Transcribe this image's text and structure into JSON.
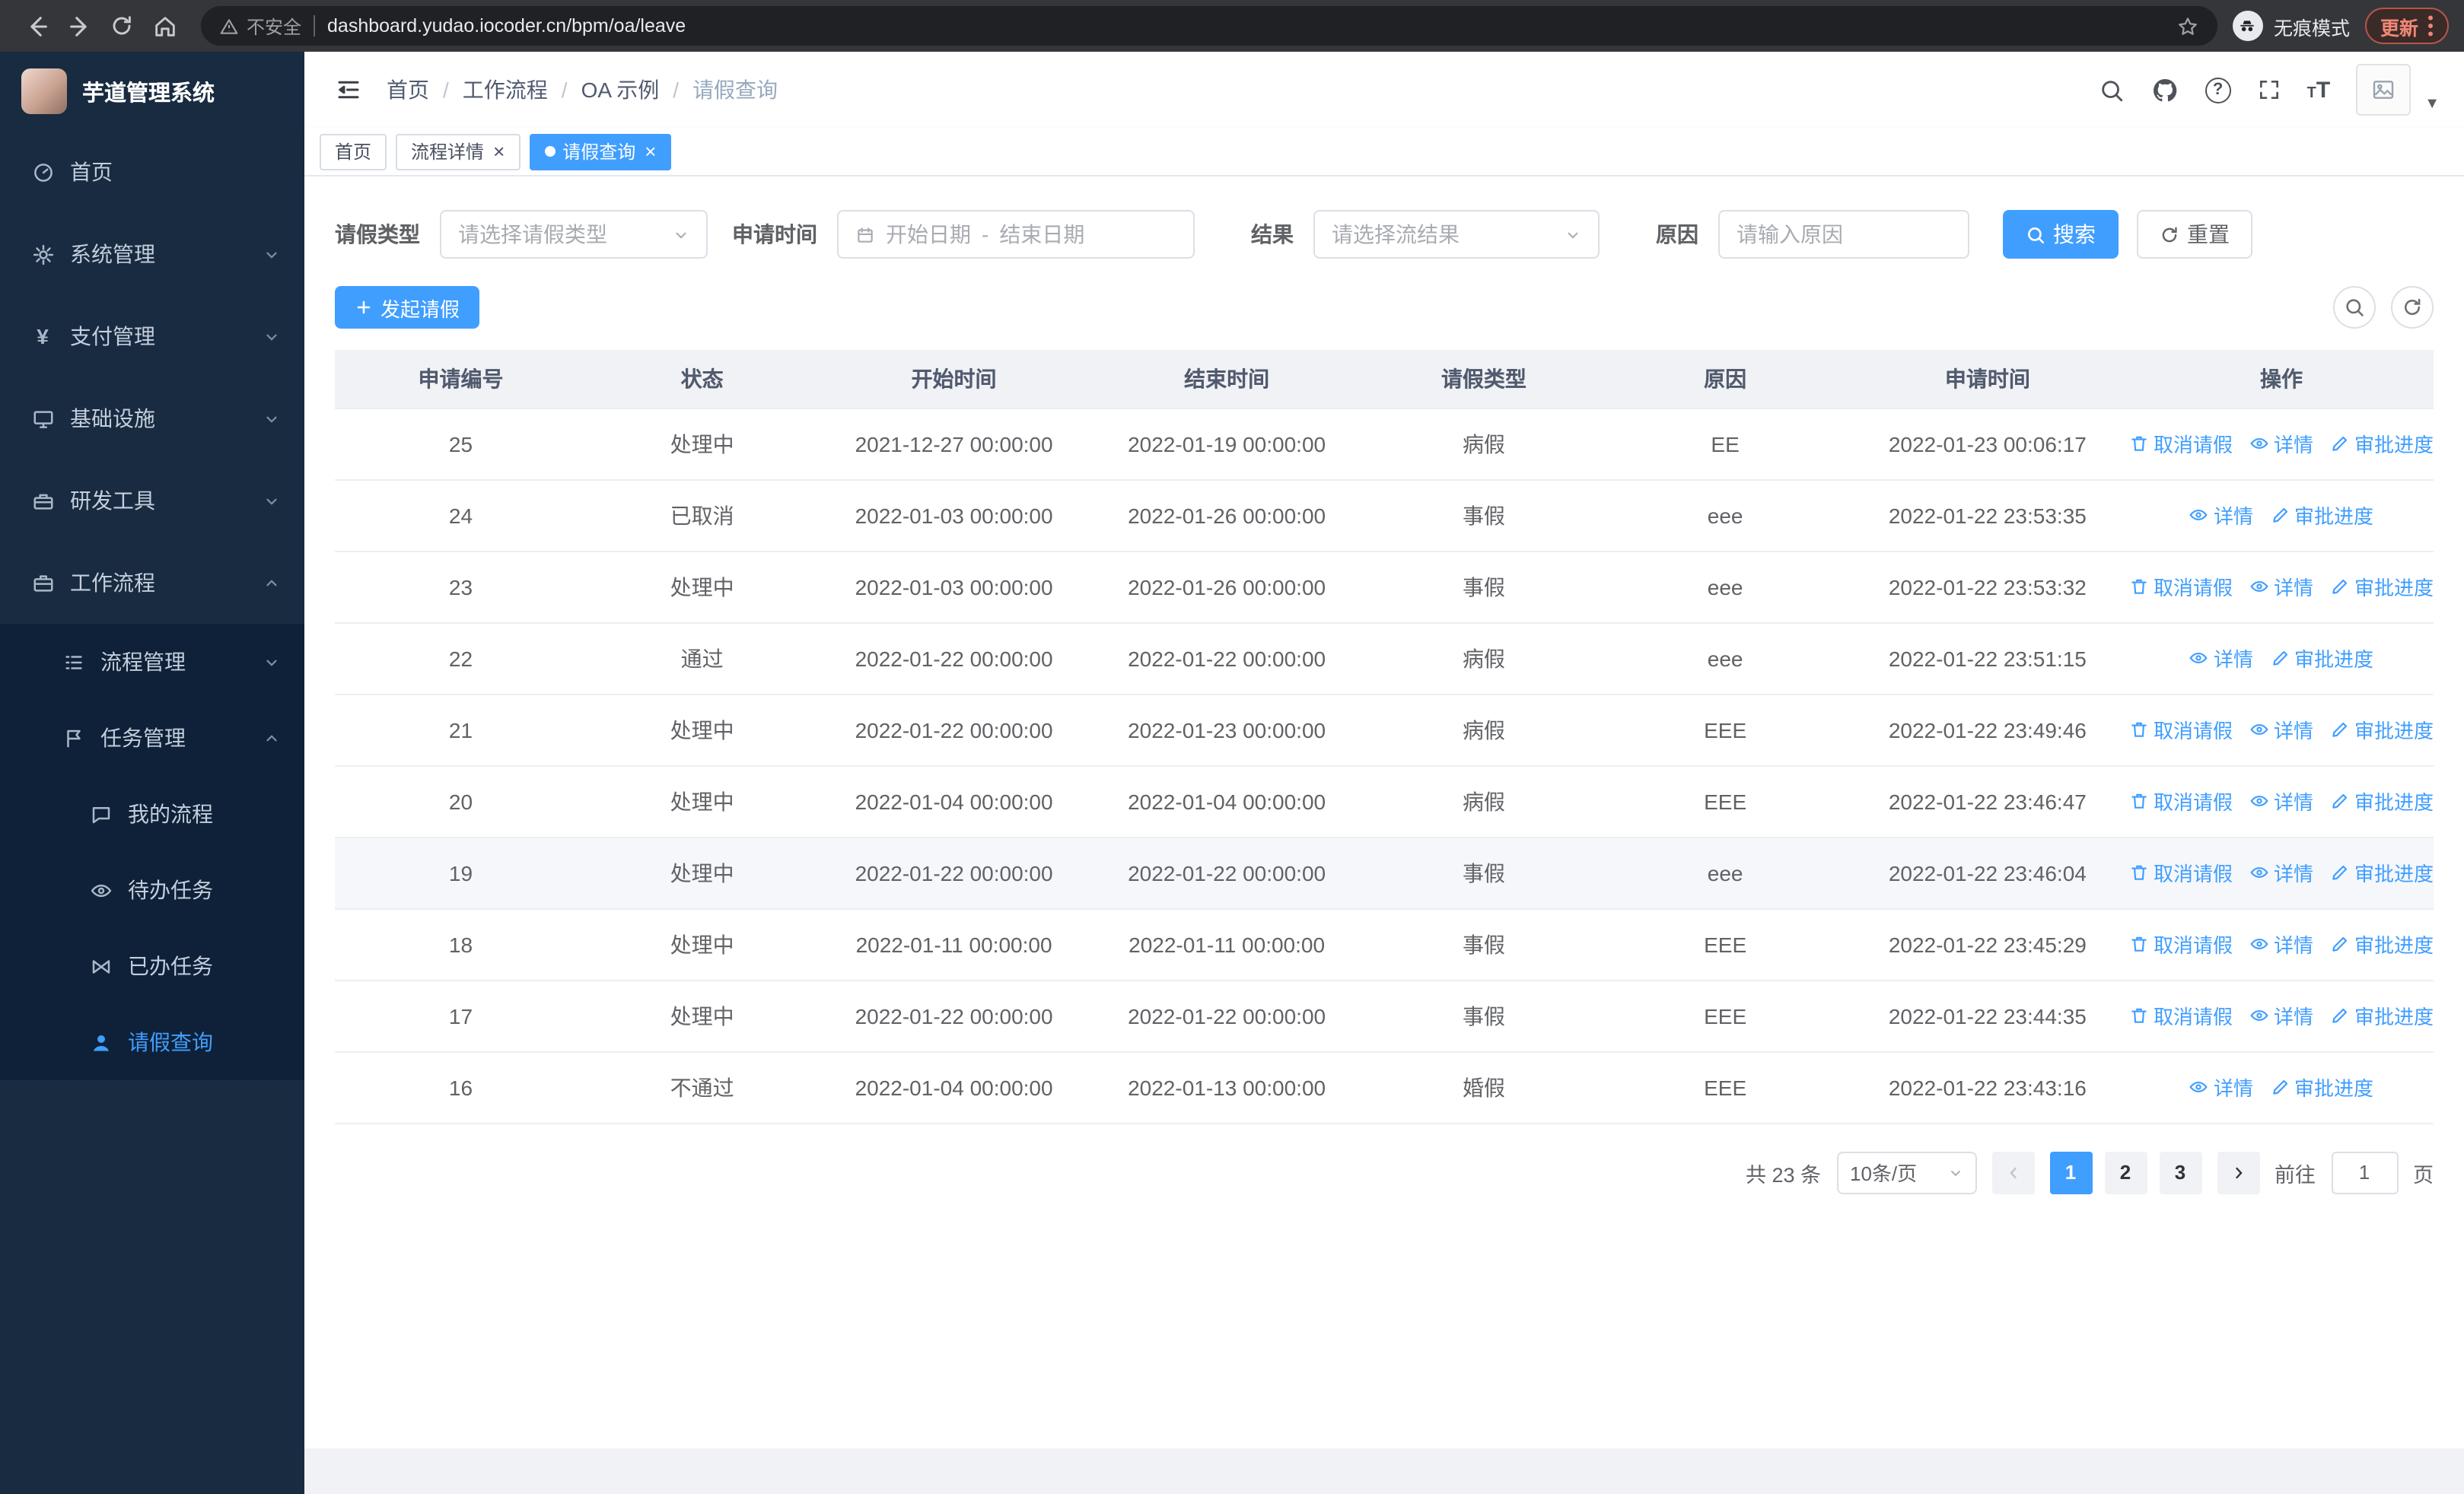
{
  "browser": {
    "security_label": "不安全",
    "url": "dashboard.yudao.iocoder.cn/bpm/oa/leave",
    "incognito_label": "无痕模式",
    "update_label": "更新"
  },
  "sidebar": {
    "title": "芋道管理系统",
    "items": [
      {
        "label": "首页",
        "icon": "dashboard-icon"
      },
      {
        "label": "系统管理",
        "icon": "gear-icon"
      },
      {
        "label": "支付管理",
        "icon": "yen-icon"
      },
      {
        "label": "基础设施",
        "icon": "infrastructure-icon"
      },
      {
        "label": "研发工具",
        "icon": "tools-icon"
      },
      {
        "label": "工作流程",
        "icon": "workflow-icon",
        "expanded": true
      }
    ],
    "workflow_children": [
      {
        "label": "流程管理",
        "icon": "process-icon"
      },
      {
        "label": "任务管理",
        "icon": "task-icon",
        "expanded": true
      }
    ],
    "task_children": [
      {
        "label": "我的流程",
        "icon": "chat-icon"
      },
      {
        "label": "待办任务",
        "icon": "eye-icon"
      },
      {
        "label": "已办任务",
        "icon": "done-icon"
      },
      {
        "label": "请假查询",
        "icon": "user-icon",
        "active": true
      }
    ]
  },
  "navbar": {
    "breadcrumb": [
      "首页",
      "工作流程",
      "OA 示例",
      "请假查询"
    ]
  },
  "tabs": [
    {
      "label": "首页"
    },
    {
      "label": "流程详情"
    },
    {
      "label": "请假查询"
    }
  ],
  "filters": {
    "leave_type_label": "请假类型",
    "leave_type_placeholder": "请选择请假类型",
    "apply_time_label": "申请时间",
    "start_date_placeholder": "开始日期",
    "date_separator": "-",
    "end_date_placeholder": "结束日期",
    "result_label": "结果",
    "result_placeholder": "请选择流结果",
    "reason_label": "原因",
    "reason_placeholder": "请输入原因",
    "search_label": "搜索",
    "reset_label": "重置"
  },
  "toolbar": {
    "create_label": "发起请假"
  },
  "table": {
    "columns": [
      "申请编号",
      "状态",
      "开始时间",
      "结束时间",
      "请假类型",
      "原因",
      "申请时间",
      "操作"
    ],
    "actions": {
      "cancel": "取消请假",
      "detail": "详情",
      "progress": "审批进度"
    },
    "rows": [
      {
        "id": "25",
        "status": "处理中",
        "start": "2021-12-27 00:00:00",
        "end": "2022-01-19 00:00:00",
        "type": "病假",
        "reason": "EE",
        "applied": "2022-01-23 00:06:17",
        "has_cancel": true
      },
      {
        "id": "24",
        "status": "已取消",
        "start": "2022-01-03 00:00:00",
        "end": "2022-01-26 00:00:00",
        "type": "事假",
        "reason": "eee",
        "applied": "2022-01-22 23:53:35",
        "has_cancel": false
      },
      {
        "id": "23",
        "status": "处理中",
        "start": "2022-01-03 00:00:00",
        "end": "2022-01-26 00:00:00",
        "type": "事假",
        "reason": "eee",
        "applied": "2022-01-22 23:53:32",
        "has_cancel": true
      },
      {
        "id": "22",
        "status": "通过",
        "start": "2022-01-22 00:00:00",
        "end": "2022-01-22 00:00:00",
        "type": "病假",
        "reason": "eee",
        "applied": "2022-01-22 23:51:15",
        "has_cancel": false
      },
      {
        "id": "21",
        "status": "处理中",
        "start": "2022-01-22 00:00:00",
        "end": "2022-01-23 00:00:00",
        "type": "病假",
        "reason": "EEE",
        "applied": "2022-01-22 23:49:46",
        "has_cancel": true
      },
      {
        "id": "20",
        "status": "处理中",
        "start": "2022-01-04 00:00:00",
        "end": "2022-01-04 00:00:00",
        "type": "病假",
        "reason": "EEE",
        "applied": "2022-01-22 23:46:47",
        "has_cancel": true
      },
      {
        "id": "19",
        "status": "处理中",
        "start": "2022-01-22 00:00:00",
        "end": "2022-01-22 00:00:00",
        "type": "事假",
        "reason": "eee",
        "applied": "2022-01-22 23:46:04",
        "has_cancel": true,
        "hover": true
      },
      {
        "id": "18",
        "status": "处理中",
        "start": "2022-01-11 00:00:00",
        "end": "2022-01-11 00:00:00",
        "type": "事假",
        "reason": "EEE",
        "applied": "2022-01-22 23:45:29",
        "has_cancel": true
      },
      {
        "id": "17",
        "status": "处理中",
        "start": "2022-01-22 00:00:00",
        "end": "2022-01-22 00:00:00",
        "type": "事假",
        "reason": "EEE",
        "applied": "2022-01-22 23:44:35",
        "has_cancel": true
      },
      {
        "id": "16",
        "status": "不通过",
        "start": "2022-01-04 00:00:00",
        "end": "2022-01-13 00:00:00",
        "type": "婚假",
        "reason": "EEE",
        "applied": "2022-01-22 23:43:16",
        "has_cancel": false
      }
    ]
  },
  "pagination": {
    "total_label": "共 23 条",
    "page_size_label": "10条/页",
    "pages": [
      {
        "label": "1",
        "active": true
      },
      {
        "label": "2"
      },
      {
        "label": "3"
      }
    ],
    "goto_label": "前往",
    "goto_value": "1",
    "unit_label": "页"
  }
}
